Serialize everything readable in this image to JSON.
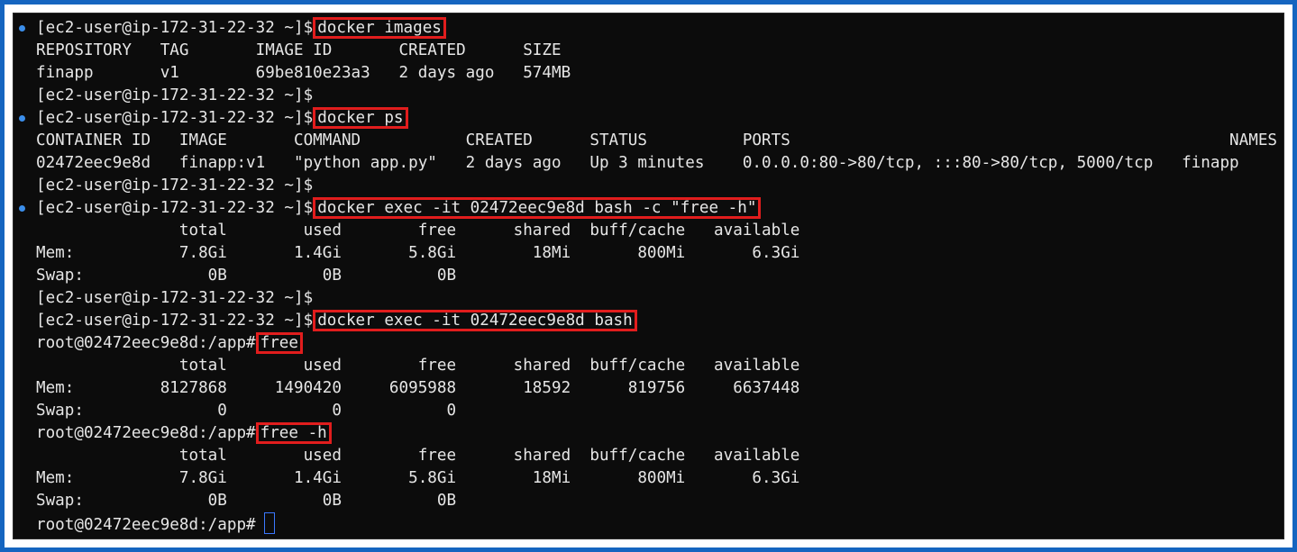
{
  "terminal": {
    "cmd1": {
      "prompt": "[ec2-user@ip-172-31-22-32 ~]$",
      "command": "docker images"
    },
    "images_header": "REPOSITORY   TAG       IMAGE ID       CREATED      SIZE",
    "images_row": "finapp       v1        69be810e23a3   2 days ago   574MB",
    "empty_prompt_1": "[ec2-user@ip-172-31-22-32 ~]$",
    "cmd2": {
      "prompt": "[ec2-user@ip-172-31-22-32 ~]$",
      "command": "docker ps"
    },
    "ps_header": "CONTAINER ID   IMAGE       COMMAND           CREATED      STATUS          PORTS                                              NAMES",
    "ps_row": "02472eec9e8d   finapp:v1   \"python app.py\"   2 days ago   Up 3 minutes    0.0.0.0:80->80/tcp, :::80->80/tcp, 5000/tcp   finapp",
    "empty_prompt_2": "[ec2-user@ip-172-31-22-32 ~]$",
    "cmd3": {
      "prompt": "[ec2-user@ip-172-31-22-32 ~]$",
      "command": "docker exec -it 02472eec9e8d bash -c \"free -h\""
    },
    "free1": {
      "header": "               total        used        free      shared  buff/cache   available",
      "mem": "Mem:           7.8Gi       1.4Gi       5.8Gi        18Mi       800Mi       6.3Gi",
      "swap": "Swap:             0B          0B          0B"
    },
    "empty_prompt_3": "[ec2-user@ip-172-31-22-32 ~]$",
    "cmd4": {
      "prompt": "[ec2-user@ip-172-31-22-32 ~]$",
      "command": "docker exec -it 02472eec9e8d bash"
    },
    "cmd5": {
      "prompt": "root@02472eec9e8d:/app#",
      "command": "free"
    },
    "free2": {
      "header": "               total        used        free      shared  buff/cache   available",
      "mem": "Mem:         8127868     1490420     6095988       18592      819756     6637448",
      "swap": "Swap:              0           0           0"
    },
    "cmd6": {
      "prompt": "root@02472eec9e8d:/app#",
      "command": "free -h"
    },
    "free3": {
      "header": "               total        used        free      shared  buff/cache   available",
      "mem": "Mem:           7.8Gi       1.4Gi       5.8Gi        18Mi       800Mi       6.3Gi",
      "swap": "Swap:             0B          0B          0B"
    },
    "final_prompt": "root@02472eec9e8d:/app#"
  },
  "colors": {
    "frame_border": "#1565c0",
    "background": "#0c0c0c",
    "text": "#e6e6e6",
    "highlight_box": "#e11d1d",
    "prompt_marker": "#3b8eea",
    "cursor": "#3b78ff"
  },
  "icons": {
    "prompt_marker": "command-status-dot-icon",
    "cursor": "text-cursor-icon"
  }
}
